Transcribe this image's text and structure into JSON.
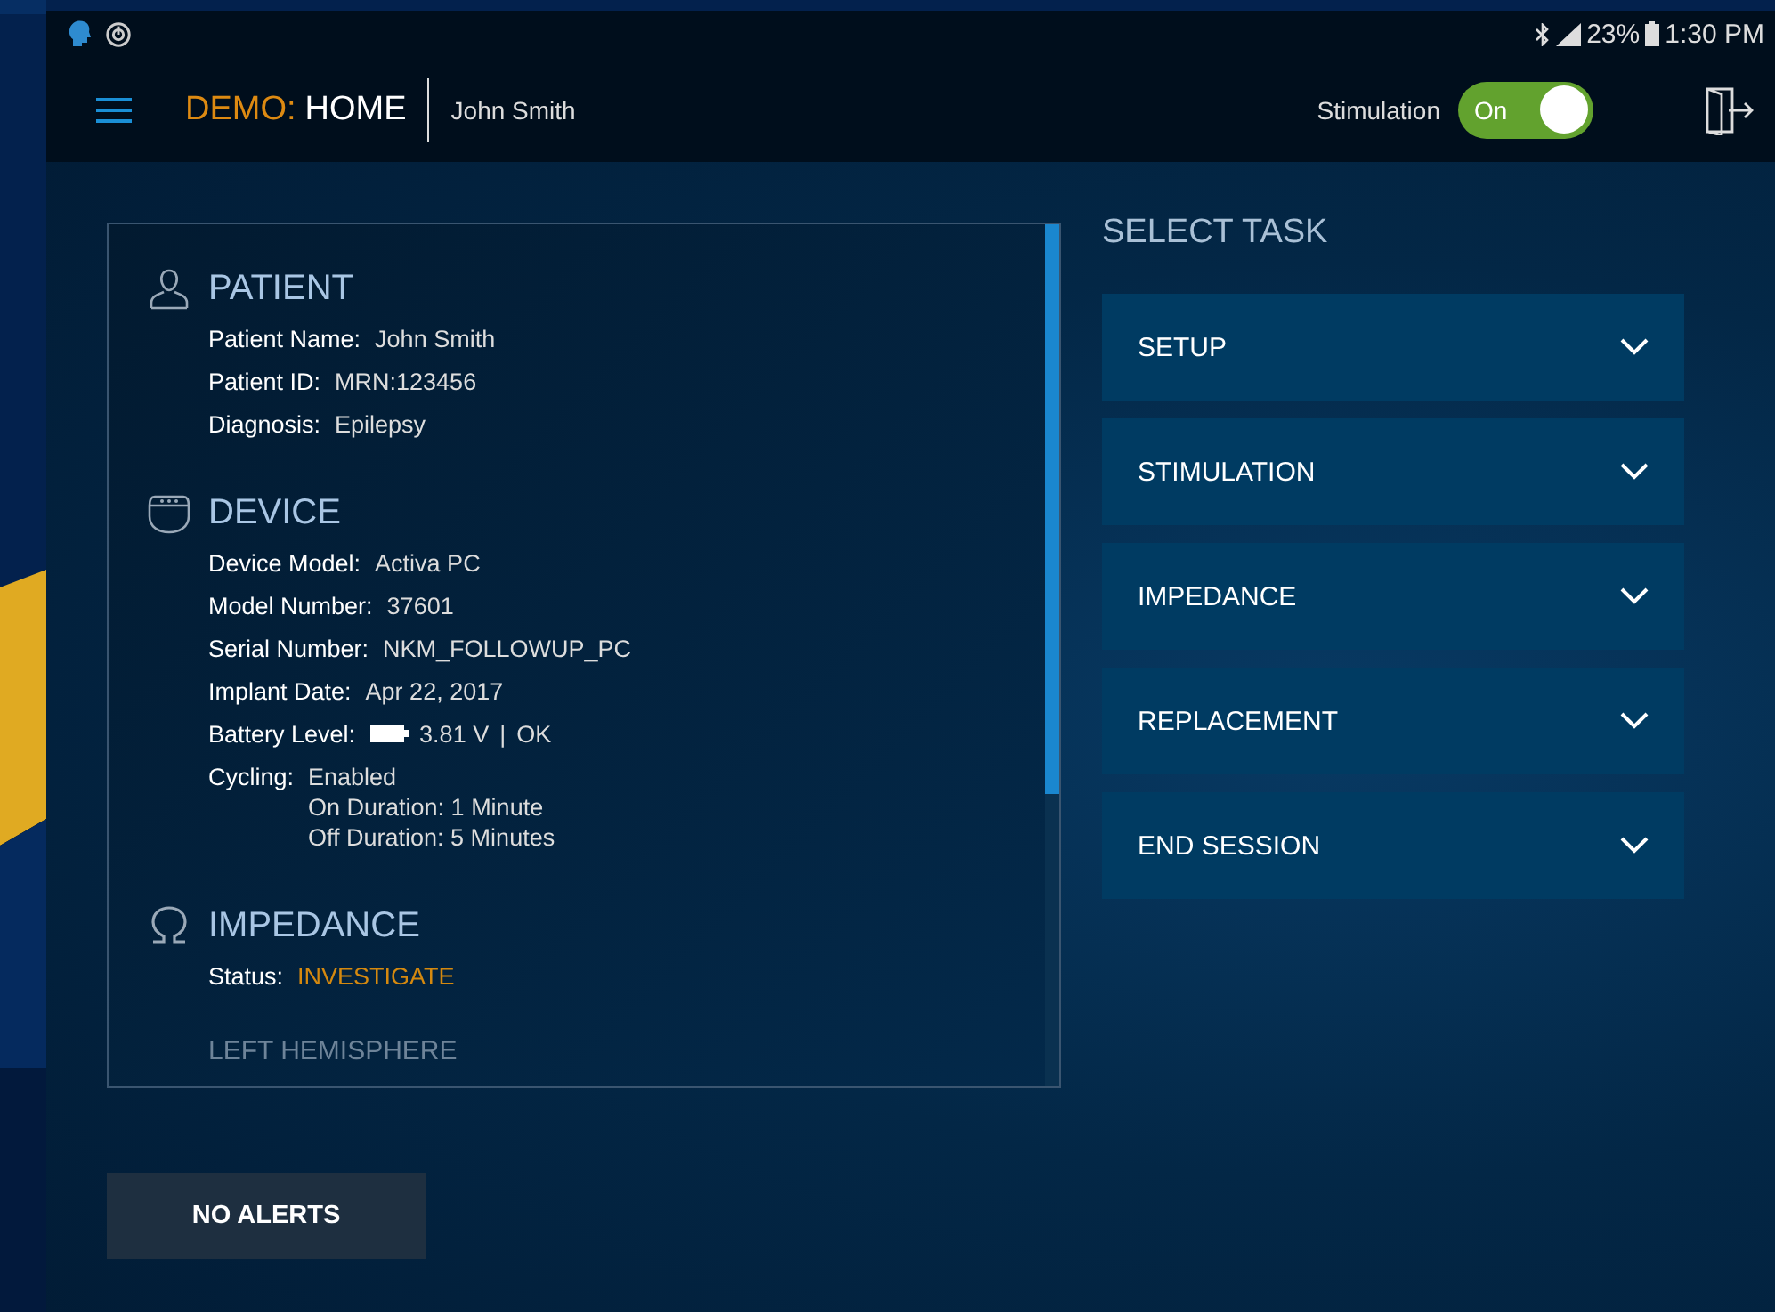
{
  "status_bar": {
    "battery": "23%",
    "time": "1:30 PM"
  },
  "header": {
    "brand": "DEMO:",
    "page": "HOME",
    "user": "John Smith",
    "stimulation": {
      "label": "Stimulation",
      "text": "On",
      "on": true
    }
  },
  "sections": [
    {
      "kind": "person",
      "title": "PATIENT",
      "rows": [
        {
          "kind": "text",
          "label": "Patient Name:",
          "lines": [
            "John Smith"
          ]
        },
        {
          "kind": "text",
          "label": "Patient ID:",
          "lines": [
            "MRN:123456"
          ]
        },
        {
          "kind": "text",
          "label": "Diagnosis:",
          "lines": [
            "Epilepsy"
          ]
        }
      ]
    },
    {
      "kind": "device",
      "title": "DEVICE",
      "rows": [
        {
          "kind": "text",
          "label": "Device Model:",
          "lines": [
            "Activa PC"
          ]
        },
        {
          "kind": "text",
          "label": "Model Number:",
          "lines": [
            "37601"
          ]
        },
        {
          "kind": "text",
          "label": "Serial Number:",
          "lines": [
            "NKM_FOLLOWUP_PC"
          ]
        },
        {
          "kind": "text",
          "label": "Implant Date:",
          "lines": [
            "Apr 22, 2017"
          ]
        },
        {
          "kind": "battery",
          "label": "Battery Level:",
          "lines": [
            "3.81 V",
            "|",
            "OK"
          ]
        },
        {
          "kind": "text",
          "label": "Cycling:",
          "lines": [
            "Enabled",
            "On Duration: 1 Minute",
            "Off Duration: 5 Minutes"
          ]
        }
      ]
    },
    {
      "kind": "omega",
      "title": "IMPEDANCE",
      "rows": [
        {
          "kind": "warning",
          "label": "Status:",
          "lines": [
            "INVESTIGATE"
          ]
        }
      ],
      "subheading": "LEFT HEMISPHERE"
    }
  ],
  "tasks": {
    "title": "SELECT TASK",
    "items": [
      {
        "label": "SETUP",
        "expanded": false
      },
      {
        "label": "STIMULATION",
        "expanded": false
      },
      {
        "label": "IMPEDANCE",
        "expanded": false
      },
      {
        "label": "REPLACEMENT",
        "expanded": false
      },
      {
        "label": "END SESSION",
        "expanded": false
      }
    ]
  },
  "alerts_button": "NO ALERTS"
}
